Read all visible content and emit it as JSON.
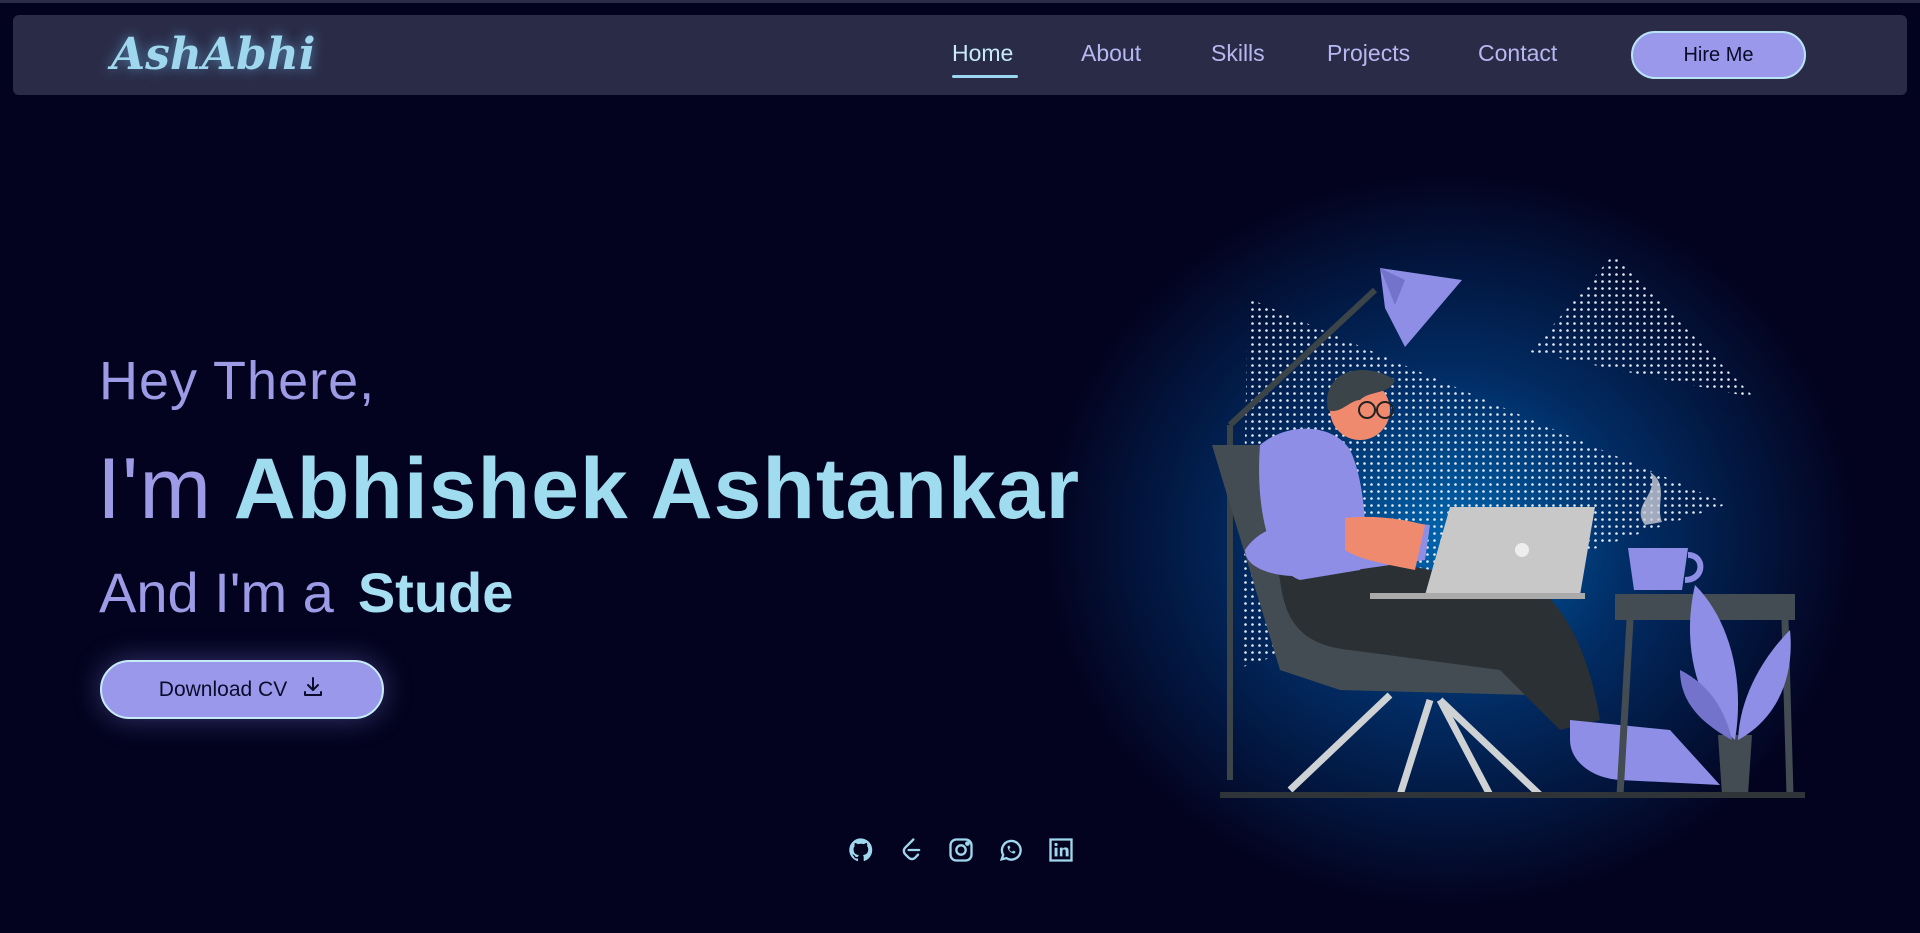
{
  "brand": {
    "logo": "AshAbhi"
  },
  "nav": {
    "links": [
      "Home",
      "About",
      "Skills",
      "Projects",
      "Contact"
    ],
    "active": "Home",
    "hire_label": "Hire Me"
  },
  "hero": {
    "greeting": "Hey There,",
    "name_prefix": "I'm",
    "name": "Abhishek Ashtankar",
    "role_prefix": "And I'm a",
    "role_typed": "Stude",
    "download_label": "Download CV"
  },
  "social": {
    "icons": [
      "github-icon",
      "leetcode-icon",
      "instagram-icon",
      "whatsapp-icon",
      "linkedin-icon"
    ]
  },
  "colors": {
    "background": "#03031f",
    "navbar": "#2a2c47",
    "accent_purple": "#9998ea",
    "accent_cyan": "#9fdcf0"
  }
}
